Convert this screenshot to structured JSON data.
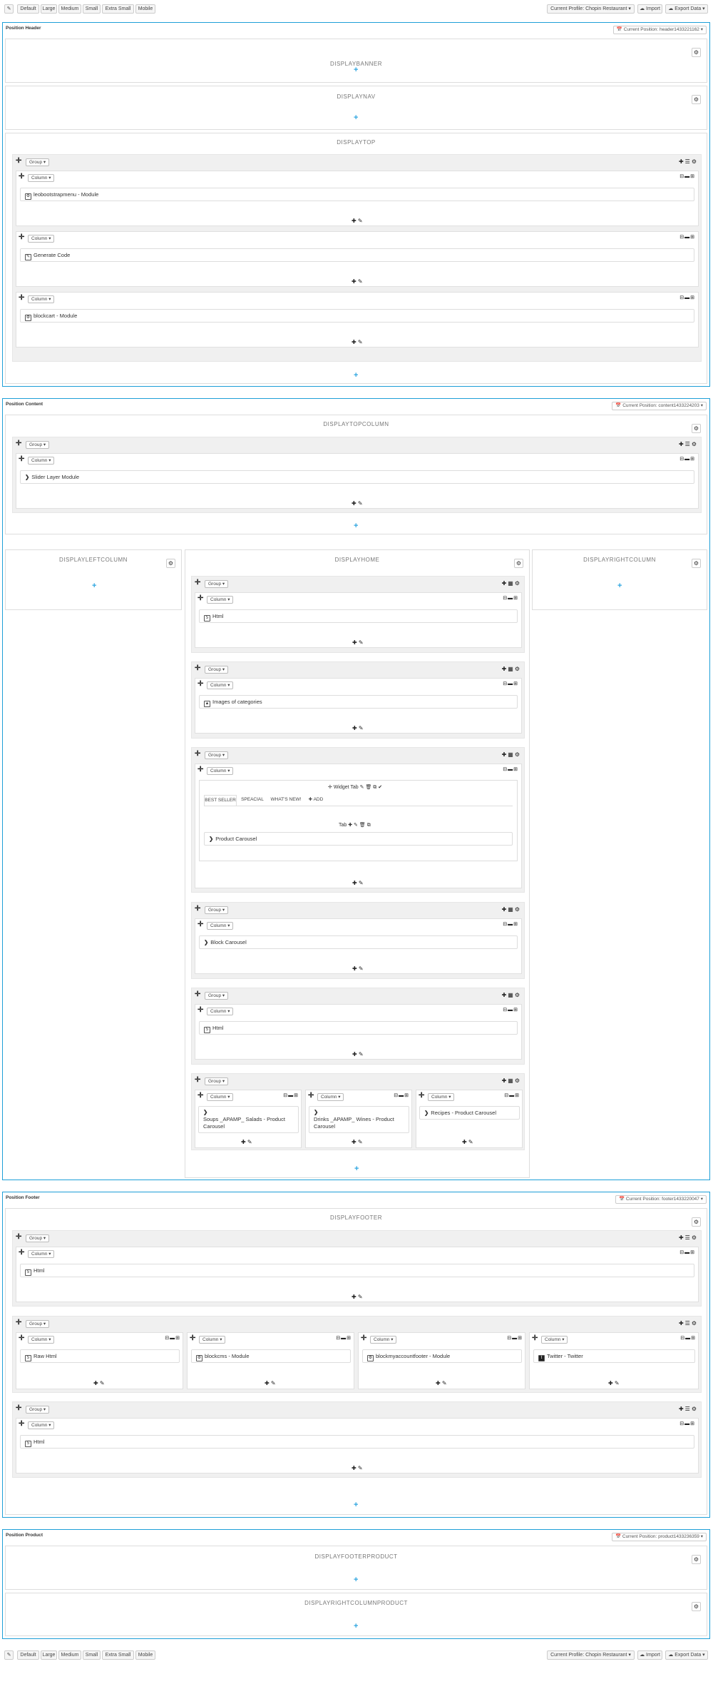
{
  "toolbar": {
    "sizes": [
      "Default",
      "Large",
      "Medium",
      "Small",
      "Extra Small",
      "Mobile"
    ],
    "profile": "Current Profile: Chopin Restaurant",
    "import": "Import",
    "export": "Export Data"
  },
  "sections": {
    "header": {
      "title": "Position Header",
      "profile": "Current Position: header1433221162",
      "hooks": {
        "banner": "DISPLAYBANNER",
        "nav": "DISPLAYNAV",
        "top": "DISPLAYTOP"
      },
      "widgets": {
        "w1": "leobootstrapmenu - Module",
        "w2": "Generate Code",
        "w3": "blockcart - Module"
      }
    },
    "content": {
      "title": "Position Content",
      "profile": "Current Position: content1433224203",
      "hooks": {
        "topcolumn": "DISPLAYTOPCOLUMN",
        "left": "DISPLAYLEFTCOLUMN",
        "home": "DISPLAYHOME",
        "right": "DISPLAYRIGHTCOLUMN"
      },
      "widgets": {
        "slider": "Slider Layer Module",
        "html1": "Html",
        "images": "Images of categories",
        "carousel": "Product Carousel",
        "block_carousel": "Block Carousel",
        "html2": "Html",
        "soups": "Soups _APAMP_ Salads - Product Carousel",
        "drinks": "Drinks _APAMP_ Wines - Product Carousel",
        "recipes": "Recipes - Product Carousel"
      },
      "tab_widget": {
        "title": "Widget Tab",
        "tabs": [
          "BEST SELLER",
          "SPEACIAL",
          "WHAT'S NEW!"
        ],
        "add": "ADD",
        "tab_label": "Tab"
      }
    },
    "footer": {
      "title": "Position Footer",
      "profile": "Current Position: footer1433220047",
      "hooks": {
        "footer": "DISPLAYFOOTER"
      },
      "widgets": {
        "html1": "Html",
        "raw": "Raw Html",
        "blockcms": "blockcms - Module",
        "myaccount": "blockmyaccountfooter - Module",
        "twitter": "Twitter - Twitter",
        "html2": "Html"
      }
    },
    "product": {
      "title": "Position Product",
      "profile": "Current Position: product1433236359",
      "hooks": {
        "footerproduct": "DISPLAYFOOTERPRODUCT",
        "rightproduct": "DISPLAYRIGHTCOLUMNPRODUCT"
      }
    }
  },
  "labels": {
    "group": "Group",
    "column": "Column"
  },
  "colors": {
    "accent": "#1e9fd8",
    "plus": "#2ea6e0"
  }
}
